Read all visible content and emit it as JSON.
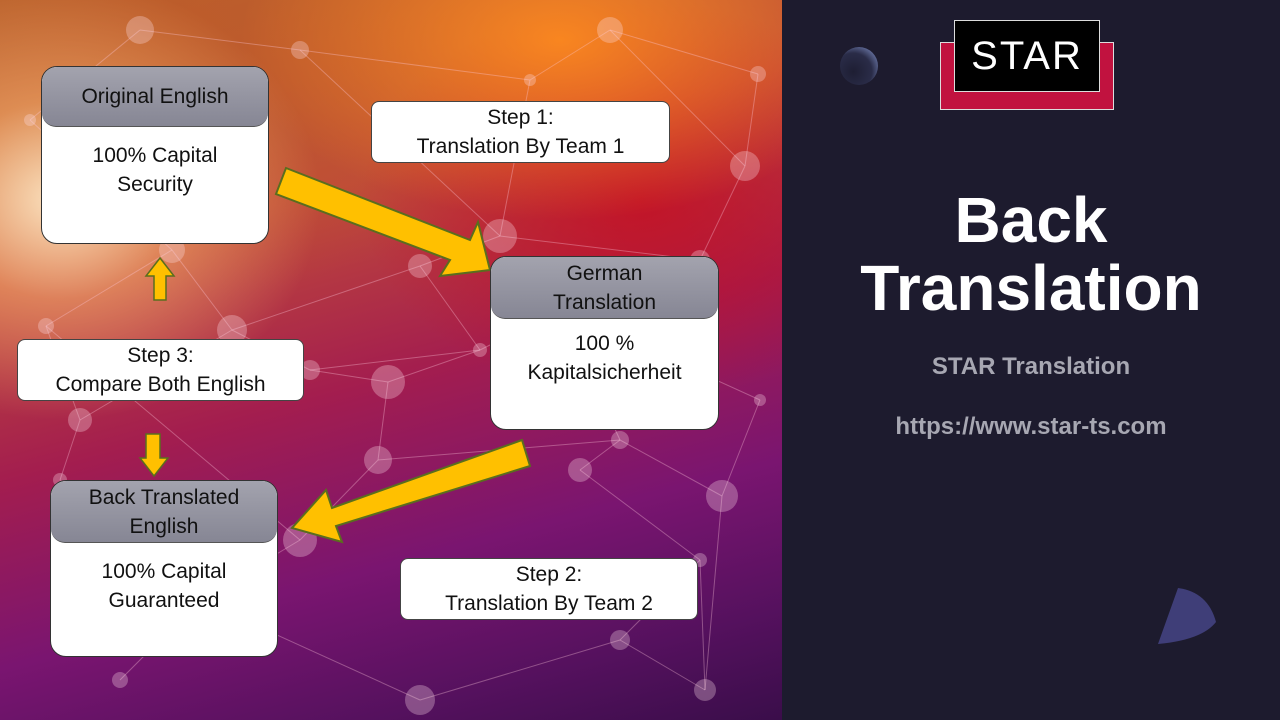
{
  "diagram": {
    "cards": {
      "original": {
        "header": "Original English",
        "body": "100% Capital\nSecurity"
      },
      "german": {
        "header_line1": "German",
        "header_line2": "Translation",
        "body": "100 %\nKapitalsicherheit"
      },
      "back": {
        "header_line1": "Back Translated",
        "header_line2": "English",
        "body": "100% Capital\nGuaranteed"
      }
    },
    "steps": [
      {
        "line1": "Step 1:",
        "line2": "Translation By Team 1"
      },
      {
        "line1": "Step 2:",
        "line2": "Translation By Team 2"
      },
      {
        "line1": "Step 3:",
        "line2": "Compare Both English"
      }
    ],
    "arrow_color": "#ffc000",
    "arrow_outline": "#5a6e1e"
  },
  "sidebar": {
    "logo_text": "STAR",
    "title_line1": "Back",
    "title_line2": "Translation",
    "company": "STAR Translation",
    "url": "https://www.star-ts.com",
    "colors": {
      "background": "#1d1b2e",
      "logo_red": "#c1123f",
      "subtitle": "#a7a7b2"
    }
  }
}
